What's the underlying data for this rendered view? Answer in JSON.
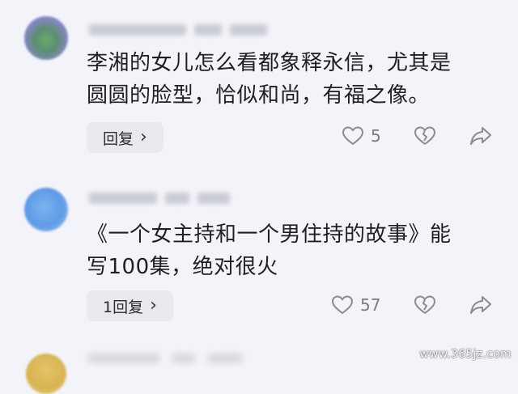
{
  "comments": [
    {
      "text_line1": "李湘的女儿怎么看都象释永信，尤其是",
      "text_line2": "圆圆的脸型，恰似和尚，有福之像。",
      "reply_label": "回复",
      "likes": "5"
    },
    {
      "text_line1": "《一个女主持和一个男住持的故事》能",
      "text_line2": "写100集，绝对很火",
      "reply_label": "1回复",
      "likes": "57"
    }
  ],
  "watermark": "www.365jz.com",
  "colors": {
    "background": "#f2f4f9",
    "reply_button": "#e8eaef",
    "icon_gray": "#8a8c94"
  }
}
